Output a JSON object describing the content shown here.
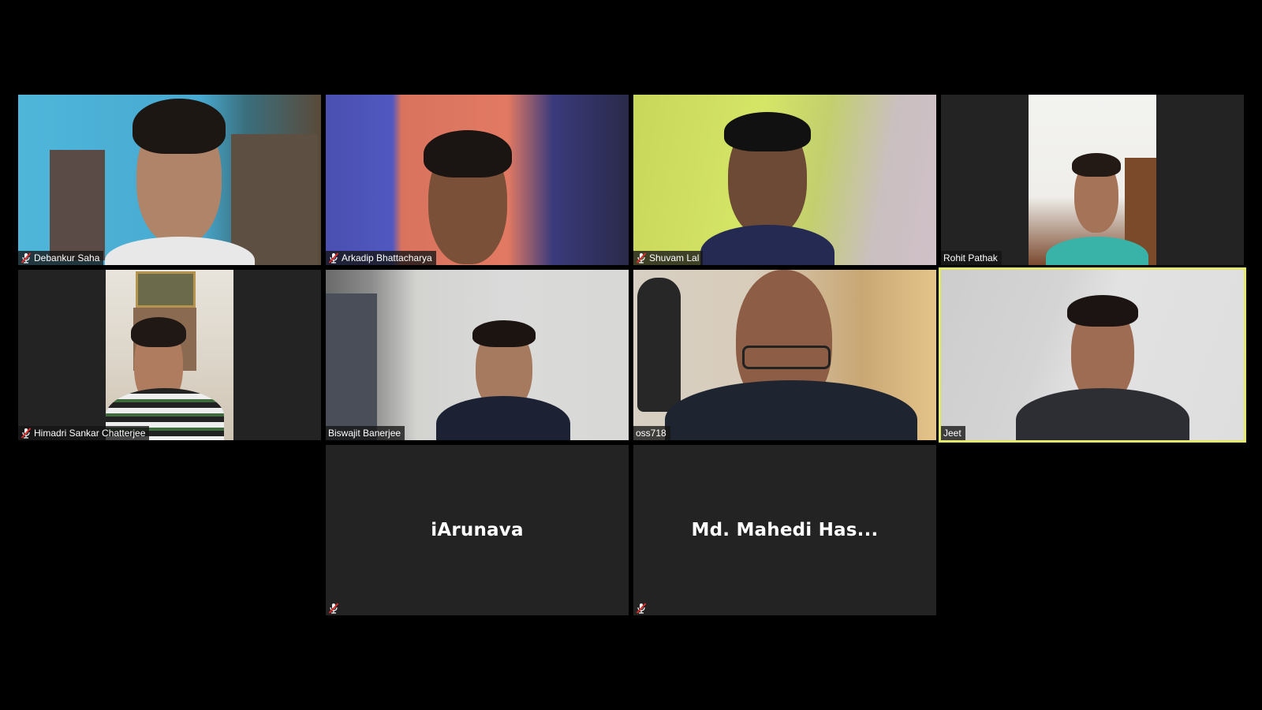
{
  "meeting": {
    "participants": [
      {
        "name": "Debankur Saha",
        "muted": true,
        "video": true
      },
      {
        "name": "Arkadip Bhattacharya",
        "muted": true,
        "video": true
      },
      {
        "name": "Shuvam Lal",
        "muted": true,
        "video": true
      },
      {
        "name": "Rohit Pathak",
        "muted": false,
        "video": true
      },
      {
        "name": "Himadri Sankar Chatterjee",
        "muted": true,
        "video": true
      },
      {
        "name": "Biswajit Banerjee",
        "muted": false,
        "video": true
      },
      {
        "name": "oss718",
        "muted": false,
        "video": true
      },
      {
        "name": "Jeet",
        "muted": false,
        "video": true,
        "active_speaker": true
      },
      {
        "name": "iArunava",
        "muted": true,
        "video": false
      },
      {
        "name": "Md. Mahedi Has...",
        "muted": true,
        "video": false
      }
    ]
  },
  "colors": {
    "background": "#000000",
    "tile_background": "#232323",
    "active_speaker_border": "#e4e96b",
    "mute_icon": "#e02a2a"
  },
  "icons": {
    "mute": "microphone-muted-icon"
  }
}
